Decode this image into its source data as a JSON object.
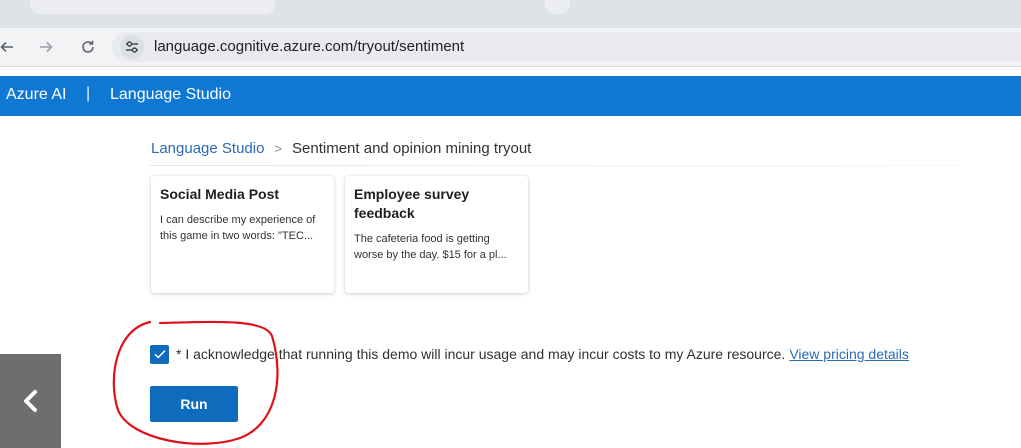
{
  "browser": {
    "url": "language.cognitive.azure.com/tryout/sentiment"
  },
  "header": {
    "brand": "Azure AI",
    "separator": "|",
    "title": "Language Studio"
  },
  "breadcrumb": {
    "root": "Language Studio",
    "separator": ">",
    "current": "Sentiment and opinion mining tryout"
  },
  "samples": [
    {
      "title": "Social Media Post",
      "preview": "I can describe my experience of this game in two words: \"TEC..."
    },
    {
      "title": "Employee survey feedback",
      "preview": "The cafeteria food is getting worse by the day. $15 for a pl..."
    }
  ],
  "acknowledgement": {
    "checked": true,
    "text": "* I acknowledge that running this demo will incur usage and may incur costs to my Azure resource.",
    "link": "View pricing details"
  },
  "run_button": {
    "label": "Run"
  },
  "icons": {
    "back": "back-arrow-icon",
    "forward": "forward-arrow-icon",
    "reload": "reload-icon",
    "site_settings": "site-settings-icon",
    "check": "checkmark-icon",
    "side_back": "chevron-left-icon"
  },
  "colors": {
    "header_blue": "#0f78d4",
    "primary_button": "#0f6cbd",
    "link": "#2b6bb5",
    "annotation_red": "#e0101a",
    "side_panel": "#6d6e70"
  }
}
